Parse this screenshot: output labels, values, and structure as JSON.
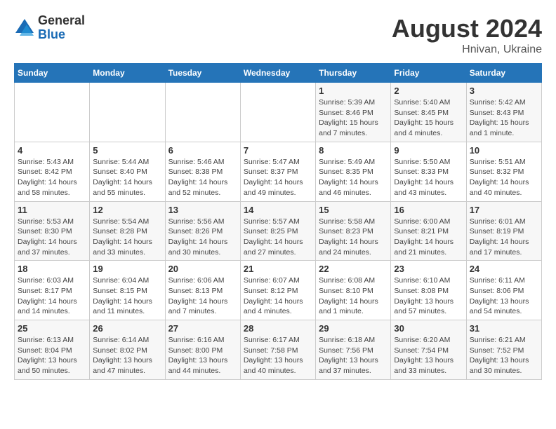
{
  "logo": {
    "general": "General",
    "blue": "Blue"
  },
  "title": "August 2024",
  "subtitle": "Hnivan, Ukraine",
  "days_of_week": [
    "Sunday",
    "Monday",
    "Tuesday",
    "Wednesday",
    "Thursday",
    "Friday",
    "Saturday"
  ],
  "weeks": [
    [
      {
        "day": "",
        "info": ""
      },
      {
        "day": "",
        "info": ""
      },
      {
        "day": "",
        "info": ""
      },
      {
        "day": "",
        "info": ""
      },
      {
        "day": "1",
        "info": "Sunrise: 5:39 AM\nSunset: 8:46 PM\nDaylight: 15 hours\nand 7 minutes."
      },
      {
        "day": "2",
        "info": "Sunrise: 5:40 AM\nSunset: 8:45 PM\nDaylight: 15 hours\nand 4 minutes."
      },
      {
        "day": "3",
        "info": "Sunrise: 5:42 AM\nSunset: 8:43 PM\nDaylight: 15 hours\nand 1 minute."
      }
    ],
    [
      {
        "day": "4",
        "info": "Sunrise: 5:43 AM\nSunset: 8:42 PM\nDaylight: 14 hours\nand 58 minutes."
      },
      {
        "day": "5",
        "info": "Sunrise: 5:44 AM\nSunset: 8:40 PM\nDaylight: 14 hours\nand 55 minutes."
      },
      {
        "day": "6",
        "info": "Sunrise: 5:46 AM\nSunset: 8:38 PM\nDaylight: 14 hours\nand 52 minutes."
      },
      {
        "day": "7",
        "info": "Sunrise: 5:47 AM\nSunset: 8:37 PM\nDaylight: 14 hours\nand 49 minutes."
      },
      {
        "day": "8",
        "info": "Sunrise: 5:49 AM\nSunset: 8:35 PM\nDaylight: 14 hours\nand 46 minutes."
      },
      {
        "day": "9",
        "info": "Sunrise: 5:50 AM\nSunset: 8:33 PM\nDaylight: 14 hours\nand 43 minutes."
      },
      {
        "day": "10",
        "info": "Sunrise: 5:51 AM\nSunset: 8:32 PM\nDaylight: 14 hours\nand 40 minutes."
      }
    ],
    [
      {
        "day": "11",
        "info": "Sunrise: 5:53 AM\nSunset: 8:30 PM\nDaylight: 14 hours\nand 37 minutes."
      },
      {
        "day": "12",
        "info": "Sunrise: 5:54 AM\nSunset: 8:28 PM\nDaylight: 14 hours\nand 33 minutes."
      },
      {
        "day": "13",
        "info": "Sunrise: 5:56 AM\nSunset: 8:26 PM\nDaylight: 14 hours\nand 30 minutes."
      },
      {
        "day": "14",
        "info": "Sunrise: 5:57 AM\nSunset: 8:25 PM\nDaylight: 14 hours\nand 27 minutes."
      },
      {
        "day": "15",
        "info": "Sunrise: 5:58 AM\nSunset: 8:23 PM\nDaylight: 14 hours\nand 24 minutes."
      },
      {
        "day": "16",
        "info": "Sunrise: 6:00 AM\nSunset: 8:21 PM\nDaylight: 14 hours\nand 21 minutes."
      },
      {
        "day": "17",
        "info": "Sunrise: 6:01 AM\nSunset: 8:19 PM\nDaylight: 14 hours\nand 17 minutes."
      }
    ],
    [
      {
        "day": "18",
        "info": "Sunrise: 6:03 AM\nSunset: 8:17 PM\nDaylight: 14 hours\nand 14 minutes."
      },
      {
        "day": "19",
        "info": "Sunrise: 6:04 AM\nSunset: 8:15 PM\nDaylight: 14 hours\nand 11 minutes."
      },
      {
        "day": "20",
        "info": "Sunrise: 6:06 AM\nSunset: 8:13 PM\nDaylight: 14 hours\nand 7 minutes."
      },
      {
        "day": "21",
        "info": "Sunrise: 6:07 AM\nSunset: 8:12 PM\nDaylight: 14 hours\nand 4 minutes."
      },
      {
        "day": "22",
        "info": "Sunrise: 6:08 AM\nSunset: 8:10 PM\nDaylight: 14 hours\nand 1 minute."
      },
      {
        "day": "23",
        "info": "Sunrise: 6:10 AM\nSunset: 8:08 PM\nDaylight: 13 hours\nand 57 minutes."
      },
      {
        "day": "24",
        "info": "Sunrise: 6:11 AM\nSunset: 8:06 PM\nDaylight: 13 hours\nand 54 minutes."
      }
    ],
    [
      {
        "day": "25",
        "info": "Sunrise: 6:13 AM\nSunset: 8:04 PM\nDaylight: 13 hours\nand 50 minutes."
      },
      {
        "day": "26",
        "info": "Sunrise: 6:14 AM\nSunset: 8:02 PM\nDaylight: 13 hours\nand 47 minutes."
      },
      {
        "day": "27",
        "info": "Sunrise: 6:16 AM\nSunset: 8:00 PM\nDaylight: 13 hours\nand 44 minutes."
      },
      {
        "day": "28",
        "info": "Sunrise: 6:17 AM\nSunset: 7:58 PM\nDaylight: 13 hours\nand 40 minutes."
      },
      {
        "day": "29",
        "info": "Sunrise: 6:18 AM\nSunset: 7:56 PM\nDaylight: 13 hours\nand 37 minutes."
      },
      {
        "day": "30",
        "info": "Sunrise: 6:20 AM\nSunset: 7:54 PM\nDaylight: 13 hours\nand 33 minutes."
      },
      {
        "day": "31",
        "info": "Sunrise: 6:21 AM\nSunset: 7:52 PM\nDaylight: 13 hours\nand 30 minutes."
      }
    ]
  ]
}
